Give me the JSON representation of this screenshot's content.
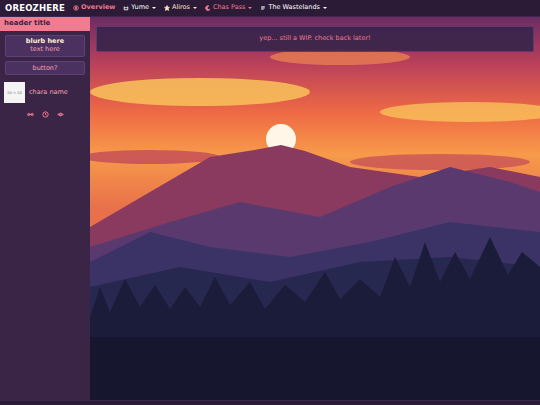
{
  "logo": "OREOZHERE",
  "nav": [
    {
      "label": "Overview",
      "selected": true,
      "dropdown": false,
      "color": "#f07a8f"
    },
    {
      "label": "Yume",
      "selected": false,
      "dropdown": true,
      "color": "#ffffff"
    },
    {
      "label": "Aliros",
      "selected": false,
      "dropdown": true,
      "color": "#ffe0c8"
    },
    {
      "label": "Chas Pass",
      "selected": false,
      "dropdown": true,
      "color": "#f07a8f"
    },
    {
      "label": "The Wastelands",
      "selected": false,
      "dropdown": true,
      "color": "#ffffff"
    }
  ],
  "sidebar": {
    "header": "header title",
    "blurb": {
      "title": "blurb here",
      "text": "text here"
    },
    "button": "button?",
    "chara": {
      "avatar": "50 × 50",
      "name": "chara name"
    }
  },
  "notice": "yep... still a WIP. check back later!"
}
